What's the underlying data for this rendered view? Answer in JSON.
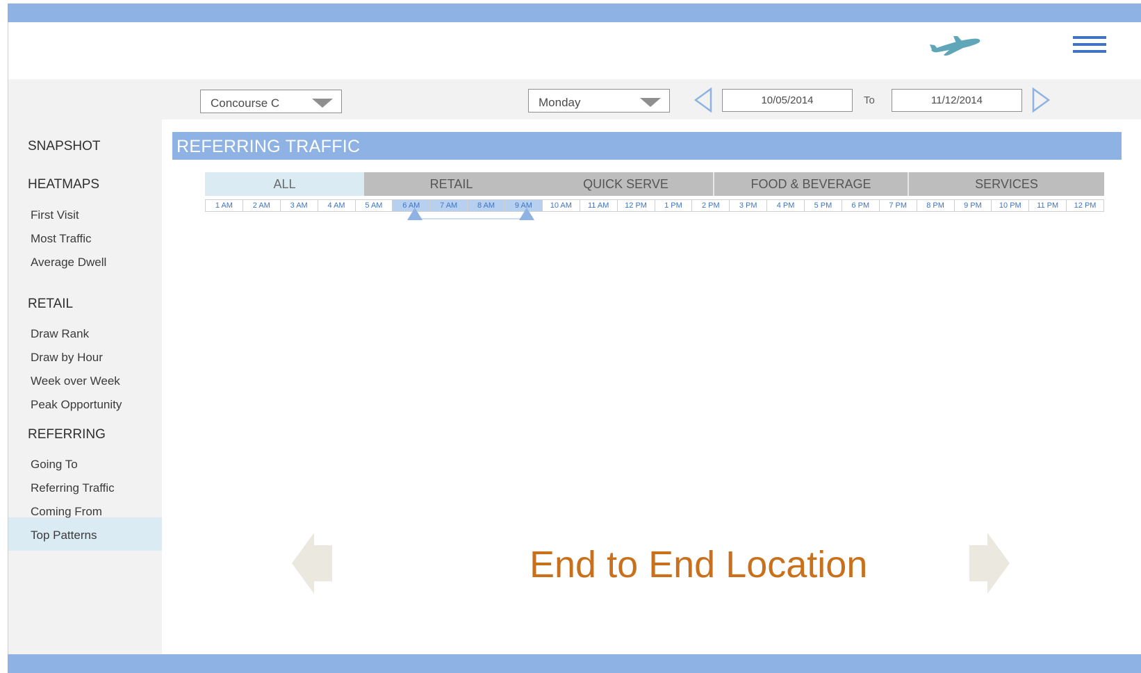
{
  "colors": {
    "accent": "#8eb2e3",
    "accent_dark": "#3f74c2",
    "plane": "#5fa6b8",
    "highlight": "#dbebf4",
    "category_grey": "#bdbdbd",
    "title_orange": "#c8701b",
    "big_arrow": "#ebe8df"
  },
  "header": {
    "logo_icon": "airplane-icon",
    "menu_icon": "hamburger-menu-icon"
  },
  "filters": {
    "location": "Concourse C",
    "day": "Monday",
    "date_from": "10/05/2014",
    "to_label": "To",
    "date_to": "11/12/2014"
  },
  "sidebar": {
    "snapshot": "SNAPSHOT",
    "heatmaps": {
      "label": "HEATMAPS",
      "items": [
        "First Visit",
        "Most Traffic",
        "Average Dwell"
      ]
    },
    "retail": {
      "label": "RETAIL",
      "items": [
        "Draw Rank",
        "Draw by Hour",
        "Week over Week",
        "Peak Opportunity"
      ]
    },
    "referring": {
      "label": "REFERRING",
      "items": [
        "Going To",
        "Referring Traffic",
        "Coming From",
        "Top Patterns"
      ]
    },
    "active_item": "Top Patterns"
  },
  "main": {
    "section_title": "REFERRING TRAFFIC",
    "categories": [
      "ALL",
      "RETAIL",
      "QUICK SERVE",
      "FOOD & BEVERAGE",
      "SERVICES"
    ],
    "active_category": "ALL",
    "hours": [
      "1 AM",
      "2 AM",
      "3 AM",
      "4 AM",
      "5 AM",
      "6 AM",
      "7 AM",
      "8 AM",
      "9 AM",
      "10 AM",
      "11 AM",
      "12 PM",
      "1 PM",
      "2 PM",
      "3 PM",
      "4 PM",
      "5 PM",
      "6 PM",
      "7 PM",
      "8 PM",
      "9 PM",
      "10 PM",
      "11 PM",
      "12 PM"
    ],
    "selected_hours": [
      "6 AM",
      "7 AM",
      "8 AM",
      "9 AM"
    ],
    "content_title": "End to End Location"
  }
}
